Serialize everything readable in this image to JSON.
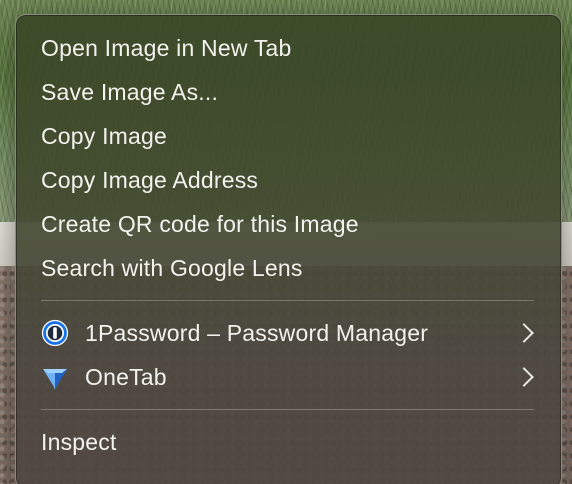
{
  "context_menu": {
    "group1": [
      {
        "label": "Open Image in New Tab"
      },
      {
        "label": "Save Image As..."
      },
      {
        "label": "Copy Image"
      },
      {
        "label": "Copy Image Address"
      },
      {
        "label": "Create QR code for this Image"
      },
      {
        "label": "Search with Google Lens"
      }
    ],
    "extensions": [
      {
        "label": "1Password – Password Manager",
        "icon": "1password-icon",
        "has_submenu": true
      },
      {
        "label": "OneTab",
        "icon": "onetab-funnel-icon",
        "has_submenu": true
      }
    ],
    "group3": [
      {
        "label": "Inspect"
      }
    ]
  },
  "colors": {
    "menu_text": "#f2f2ee",
    "onepassword_blue": "#1a73e8",
    "onetab_blue": "#2f7ee0"
  }
}
